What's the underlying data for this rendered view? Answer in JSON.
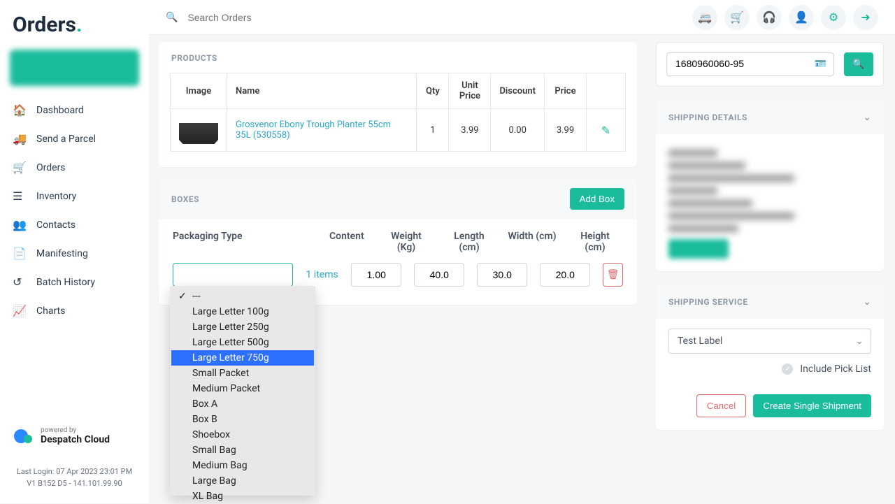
{
  "brand": {
    "name": "Orders",
    "powered_small": "powered by",
    "powered_brand": "Despatch Cloud"
  },
  "nav": {
    "items": [
      {
        "label": "Dashboard"
      },
      {
        "label": "Send a Parcel"
      },
      {
        "label": "Orders"
      },
      {
        "label": "Inventory"
      },
      {
        "label": "Contacts"
      },
      {
        "label": "Manifesting"
      },
      {
        "label": "Batch History"
      },
      {
        "label": "Charts"
      }
    ]
  },
  "footer": {
    "last_login": "Last Login: 07 Apr 2023 23:01 PM",
    "version": "V1 B152 D5 - 141.101.99.90"
  },
  "search": {
    "placeholder": "Search Orders"
  },
  "products": {
    "title": "PRODUCTS",
    "headers": {
      "image": "Image",
      "name": "Name",
      "qty": "Qty",
      "unit": "Unit Price",
      "discount": "Discount",
      "price": "Price"
    },
    "rows": [
      {
        "name": "Grosvenor Ebony Trough Planter 55cm 35L (530558)",
        "qty": "1",
        "unit": "3.99",
        "discount": "0.00",
        "price": "3.99"
      }
    ]
  },
  "boxes": {
    "title": "BOXES",
    "add": "Add Box",
    "headers": {
      "pkg": "Packaging Type",
      "content": "Content",
      "weight": "Weight (Kg)",
      "length": "Length (cm)",
      "width": "Width (cm)",
      "height": "Height (cm)"
    },
    "row": {
      "content": "1 items",
      "weight": "1.00",
      "length": "40.0",
      "width": "30.0",
      "height": "20.0"
    },
    "options": [
      "---",
      "Large Letter 100g",
      "Large Letter 250g",
      "Large Letter 500g",
      "Large Letter 750g",
      "Small Packet",
      "Medium Packet",
      "Box A",
      "Box B",
      "Shoebox",
      "Small Bag",
      "Medium Bag",
      "Large Bag",
      "XL Bag"
    ],
    "selected_index": 0,
    "highlight_index": 4
  },
  "right": {
    "search_value": "1680960060-95",
    "details_title": "SHIPPING DETAILS",
    "service_title": "SHIPPING SERVICE",
    "service_value": "Test Label",
    "pick_label": "Include Pick List",
    "cancel": "Cancel",
    "create": "Create Single Shipment"
  }
}
